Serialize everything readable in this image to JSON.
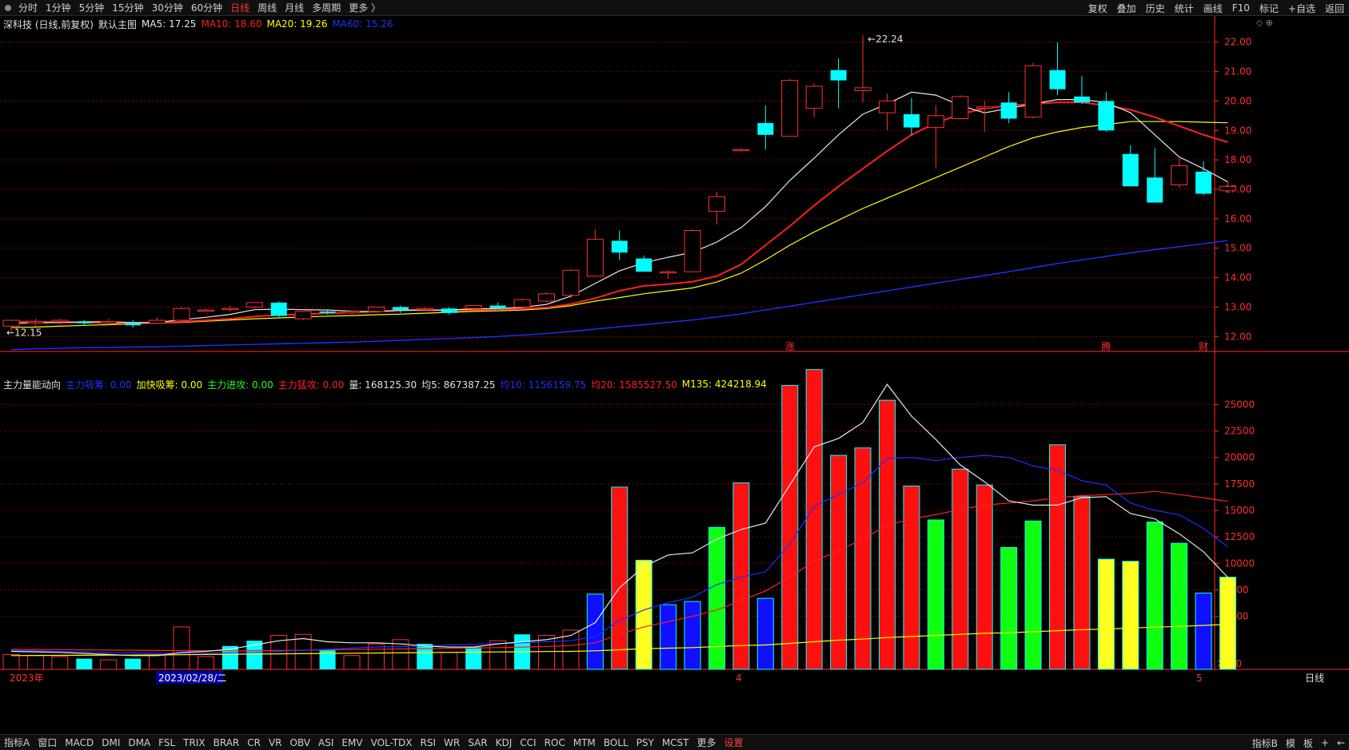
{
  "toolbar": {
    "periods": [
      "分时",
      "1分钟",
      "5分钟",
      "15分钟",
      "30分钟",
      "60分钟",
      "日线",
      "周线",
      "月线",
      "多周期",
      "更多 〉"
    ],
    "active_period": "日线",
    "actions": [
      "复权",
      "叠加",
      "历史",
      "统计",
      "画线",
      "F10",
      "标记",
      "+自选",
      "返回"
    ]
  },
  "main_legend": {
    "title": "深科技 (日线,前复权)",
    "template": "默认主图",
    "ma5": {
      "label": "MA5: 17.25",
      "color": "#e8e8e8"
    },
    "ma10": {
      "label": "MA10: 18.60",
      "color": "#ff2020"
    },
    "ma20": {
      "label": "MA20: 19.26",
      "color": "#ffff00"
    },
    "ma60": {
      "label": "MA60: 15.26",
      "color": "#2030ff"
    }
  },
  "sub_legend": {
    "title": "主力量能动向",
    "items": [
      {
        "label": "主力吸筹: 0.00",
        "color": "#2030ff"
      },
      {
        "label": "加快吸筹: 0.00",
        "color": "#ffff00"
      },
      {
        "label": "主力进攻: 0.00",
        "color": "#20ff20"
      },
      {
        "label": "主力猛攻: 0.00",
        "color": "#ff2020"
      },
      {
        "label": "量: 168125.30",
        "color": "#e0e0e0"
      },
      {
        "label": "均5: 867387.25",
        "color": "#e0e0e0"
      },
      {
        "label": "均10: 1156159.75",
        "color": "#2030ff"
      },
      {
        "label": "均20: 1585527.50",
        "color": "#ff2020"
      },
      {
        "label": "M135: 424218.94",
        "color": "#ffff00"
      }
    ]
  },
  "price_axis": [
    "22.00",
    "21.00",
    "20.00",
    "19.00",
    "18.00",
    "17.00",
    "16.00",
    "15.00",
    "14.00",
    "13.00",
    "12.00"
  ],
  "volume_axis": [
    "25000",
    "22500",
    "20000",
    "17500",
    "15000",
    "12500",
    "10000",
    "7500",
    "5000"
  ],
  "volume_unit": "X100",
  "annotations": {
    "high": "22.24",
    "low": "12.15",
    "markers": [
      "涨",
      "腾",
      "财"
    ]
  },
  "time_axis": {
    "year_label": "2023年",
    "cursor_date": "2023/02/28/二",
    "month_marks": [
      "4",
      "5"
    ]
  },
  "bottombar": {
    "tabs": [
      "指标A",
      "窗口",
      "MACD",
      "DMI",
      "DMA",
      "FSL",
      "TRIX",
      "BRAR",
      "CR",
      "VR",
      "OBV",
      "ASI",
      "EMV",
      "VOL-TDX",
      "RSI",
      "WR",
      "SAR",
      "KDJ",
      "CCI",
      "ROC",
      "MTM",
      "BOLL",
      "PSY",
      "MCST",
      "更多",
      "设置"
    ],
    "right": [
      "指标B",
      "模",
      "板",
      "+",
      "←"
    ]
  },
  "right_labels": {
    "period": "日线"
  },
  "colors": {
    "up": "#ff3030",
    "down": "#00ffff",
    "grid": "#8b0000",
    "axis": "#ff3030"
  },
  "chart_data": [
    {
      "type": "candlestick",
      "title": "深科技 (日线,前复权)",
      "ylim": [
        11.6,
        22.4
      ],
      "candles": [
        {
          "o": 12.35,
          "h": 12.55,
          "l": 12.15,
          "c": 12.55
        },
        {
          "o": 12.45,
          "h": 12.6,
          "l": 12.35,
          "c": 12.5
        },
        {
          "o": 12.5,
          "h": 12.6,
          "l": 12.4,
          "c": 12.55
        },
        {
          "o": 12.5,
          "h": 12.55,
          "l": 12.4,
          "c": 12.45
        },
        {
          "o": 12.45,
          "h": 12.6,
          "l": 12.4,
          "c": 12.5
        },
        {
          "o": 12.45,
          "h": 12.55,
          "l": 12.3,
          "c": 12.38
        },
        {
          "o": 12.45,
          "h": 12.65,
          "l": 12.45,
          "c": 12.55
        },
        {
          "o": 12.55,
          "h": 13.0,
          "l": 12.5,
          "c": 12.95
        },
        {
          "o": 12.88,
          "h": 12.95,
          "l": 12.85,
          "c": 12.9
        },
        {
          "o": 12.95,
          "h": 13.05,
          "l": 12.85,
          "c": 12.95
        },
        {
          "o": 13.0,
          "h": 13.15,
          "l": 12.95,
          "c": 13.15
        },
        {
          "o": 13.15,
          "h": 13.2,
          "l": 12.65,
          "c": 12.7
        },
        {
          "o": 12.6,
          "h": 12.85,
          "l": 12.55,
          "c": 12.85
        },
        {
          "o": 12.85,
          "h": 12.9,
          "l": 12.75,
          "c": 12.8
        },
        {
          "o": 12.8,
          "h": 12.85,
          "l": 12.75,
          "c": 12.85
        },
        {
          "o": 12.85,
          "h": 13.0,
          "l": 12.8,
          "c": 13.0
        },
        {
          "o": 13.0,
          "h": 13.05,
          "l": 12.8,
          "c": 12.9
        },
        {
          "o": 12.95,
          "h": 13.0,
          "l": 12.9,
          "c": 12.95
        },
        {
          "o": 12.95,
          "h": 13.0,
          "l": 12.75,
          "c": 12.8
        },
        {
          "o": 12.95,
          "h": 13.05,
          "l": 12.9,
          "c": 13.05
        },
        {
          "o": 13.05,
          "h": 13.15,
          "l": 12.95,
          "c": 12.95
        },
        {
          "o": 13.0,
          "h": 13.3,
          "l": 12.95,
          "c": 13.25
        },
        {
          "o": 13.2,
          "h": 13.5,
          "l": 13.15,
          "c": 13.45
        },
        {
          "o": 13.4,
          "h": 14.3,
          "l": 13.3,
          "c": 14.25
        },
        {
          "o": 14.05,
          "h": 15.65,
          "l": 14.05,
          "c": 15.3
        },
        {
          "o": 15.25,
          "h": 15.6,
          "l": 14.6,
          "c": 14.85
        },
        {
          "o": 14.65,
          "h": 14.75,
          "l": 14.2,
          "c": 14.2
        },
        {
          "o": 14.2,
          "h": 14.25,
          "l": 13.95,
          "c": 14.2
        },
        {
          "o": 14.2,
          "h": 15.65,
          "l": 14.2,
          "c": 15.6
        },
        {
          "o": 16.25,
          "h": 16.9,
          "l": 15.8,
          "c": 16.75
        },
        {
          "o": 18.35,
          "h": 18.4,
          "l": 18.3,
          "c": 18.35
        },
        {
          "o": 19.25,
          "h": 19.85,
          "l": 18.35,
          "c": 18.85
        },
        {
          "o": 18.8,
          "h": 20.75,
          "l": 18.8,
          "c": 20.7
        },
        {
          "o": 19.75,
          "h": 20.6,
          "l": 19.45,
          "c": 20.5
        },
        {
          "o": 21.05,
          "h": 21.45,
          "l": 19.75,
          "c": 20.7
        },
        {
          "o": 20.35,
          "h": 22.24,
          "l": 19.95,
          "c": 20.45
        },
        {
          "o": 19.6,
          "h": 20.25,
          "l": 19.0,
          "c": 20.0
        },
        {
          "o": 19.55,
          "h": 20.1,
          "l": 18.85,
          "c": 19.1
        },
        {
          "o": 19.1,
          "h": 19.85,
          "l": 17.7,
          "c": 19.5
        },
        {
          "o": 19.4,
          "h": 20.2,
          "l": 19.4,
          "c": 20.15
        },
        {
          "o": 19.75,
          "h": 20.0,
          "l": 18.95,
          "c": 19.8
        },
        {
          "o": 19.95,
          "h": 20.3,
          "l": 19.25,
          "c": 19.4
        },
        {
          "o": 19.45,
          "h": 21.3,
          "l": 19.4,
          "c": 21.2
        },
        {
          "o": 21.05,
          "h": 22.0,
          "l": 20.2,
          "c": 20.4
        },
        {
          "o": 20.15,
          "h": 20.85,
          "l": 19.9,
          "c": 19.95
        },
        {
          "o": 20.0,
          "h": 20.3,
          "l": 18.95,
          "c": 19.0
        },
        {
          "o": 18.2,
          "h": 18.5,
          "l": 17.1,
          "c": 17.1
        },
        {
          "o": 17.4,
          "h": 18.4,
          "l": 16.55,
          "c": 16.55
        },
        {
          "o": 17.15,
          "h": 18.1,
          "l": 17.05,
          "c": 17.8
        },
        {
          "o": 17.6,
          "h": 17.95,
          "l": 16.8,
          "c": 16.85
        },
        {
          "o": 16.95,
          "h": 17.25,
          "l": 16.95,
          "c": 17.1
        }
      ],
      "ma5": [
        12.45,
        12.46,
        12.48,
        12.5,
        12.5,
        12.47,
        12.48,
        12.57,
        12.65,
        12.75,
        12.91,
        12.93,
        12.91,
        12.9,
        12.86,
        12.84,
        12.88,
        12.9,
        12.9,
        12.94,
        12.95,
        12.99,
        13.09,
        13.37,
        13.8,
        14.23,
        14.5,
        14.69,
        14.86,
        15.21,
        15.7,
        16.41,
        17.3,
        18.06,
        18.85,
        19.55,
        19.9,
        20.3,
        20.2,
        19.85,
        19.6,
        19.75,
        19.9,
        20.05,
        20.05,
        19.95,
        19.6,
        18.85,
        18.1,
        17.7,
        17.25
      ],
      "ma10": [
        12.5,
        12.5,
        12.48,
        12.47,
        12.46,
        12.45,
        12.46,
        12.5,
        12.55,
        12.6,
        12.68,
        12.73,
        12.75,
        12.79,
        12.81,
        12.85,
        12.9,
        12.9,
        12.88,
        12.9,
        12.91,
        12.94,
        12.98,
        13.1,
        13.3,
        13.55,
        13.72,
        13.78,
        13.86,
        14.05,
        14.45,
        15.1,
        15.75,
        16.45,
        17.1,
        17.7,
        18.3,
        18.85,
        19.25,
        19.55,
        19.75,
        19.85,
        19.9,
        19.95,
        19.95,
        19.85,
        19.7,
        19.45,
        19.15,
        18.85,
        18.6
      ],
      "ma20": [
        12.3,
        12.32,
        12.35,
        12.38,
        12.4,
        12.43,
        12.45,
        12.48,
        12.52,
        12.56,
        12.6,
        12.63,
        12.66,
        12.69,
        12.71,
        12.74,
        12.76,
        12.79,
        12.82,
        12.85,
        12.87,
        12.9,
        12.95,
        13.05,
        13.2,
        13.32,
        13.45,
        13.55,
        13.65,
        13.85,
        14.15,
        14.6,
        15.1,
        15.55,
        15.95,
        16.35,
        16.7,
        17.05,
        17.4,
        17.75,
        18.1,
        18.45,
        18.75,
        18.95,
        19.1,
        19.2,
        19.3,
        19.3,
        19.3,
        19.28,
        19.26
      ],
      "ma60": [
        11.55,
        11.58,
        11.6,
        11.62,
        11.63,
        11.64,
        11.65,
        11.67,
        11.69,
        11.71,
        11.73,
        11.75,
        11.77,
        11.79,
        11.81,
        11.84,
        11.87,
        11.9,
        11.93,
        11.96,
        12.0,
        12.05,
        12.1,
        12.17,
        12.25,
        12.33,
        12.4,
        12.48,
        12.56,
        12.66,
        12.77,
        12.9,
        13.03,
        13.16,
        13.29,
        13.42,
        13.55,
        13.68,
        13.81,
        13.94,
        14.07,
        14.2,
        14.34,
        14.48,
        14.6,
        14.72,
        14.84,
        14.95,
        15.05,
        15.15,
        15.26
      ]
    },
    {
      "type": "bar",
      "title": "主力量能动向",
      "ylim": [
        0,
        28500
      ],
      "volumes": [
        1400,
        1300,
        1200,
        1000,
        900,
        1000,
        1300,
        4000,
        1200,
        2200,
        2700,
        3200,
        3300,
        1800,
        1300,
        2400,
        2800,
        2400,
        1600,
        2100,
        2700,
        3300,
        3200,
        3700,
        7100,
        17200,
        10300,
        6100,
        6400,
        13400,
        17600,
        6700,
        26800,
        28300,
        20200,
        20900,
        25400,
        17300,
        14100,
        18900,
        17400,
        11500,
        14000,
        21200,
        16300,
        10400,
        10200,
        13900,
        11900,
        7200,
        8700
      ],
      "bar_types": [
        "up",
        "up",
        "up",
        "down",
        "up",
        "down",
        "up",
        "up",
        "up",
        "down",
        "down",
        "up",
        "up",
        "down",
        "up",
        "up",
        "up",
        "down",
        "up",
        "down",
        "up",
        "down",
        "up",
        "up",
        "blue",
        "red",
        "yellow",
        "blue",
        "blue",
        "green",
        "red",
        "blue",
        "red",
        "red",
        "red",
        "red",
        "red",
        "red",
        "green",
        "red",
        "red",
        "green",
        "green",
        "red",
        "red",
        "yellow",
        "yellow",
        "green",
        "green",
        "blue",
        "yellow"
      ],
      "ma5": [
        1700,
        1650,
        1600,
        1500,
        1400,
        1300,
        1300,
        1600,
        1700,
        1900,
        2300,
        2700,
        2900,
        2600,
        2500,
        2500,
        2400,
        2200,
        2100,
        2100,
        2400,
        2600,
        2800,
        3200,
        4400,
        7700,
        9700,
        10800,
        11000,
        12300,
        13200,
        13800,
        17400,
        21000,
        21800,
        23300,
        26900,
        23900,
        21700,
        19300,
        17700,
        15900,
        15500,
        15500,
        16200,
        16300,
        14700,
        14200,
        12800,
        11100,
        8673
      ],
      "ma10": [
        1800,
        1750,
        1700,
        1650,
        1600,
        1550,
        1500,
        1500,
        1520,
        1560,
        1600,
        1700,
        1800,
        1900,
        2000,
        2100,
        2150,
        2200,
        2300,
        2350,
        2450,
        2500,
        2600,
        2700,
        3100,
        4600,
        5600,
        6300,
        6800,
        8000,
        8700,
        9200,
        11800,
        15400,
        16500,
        17600,
        19900,
        20000,
        19700,
        20000,
        20200,
        20000,
        19200,
        18800,
        17800,
        17400,
        15700,
        15000,
        14600,
        13300,
        11562
      ],
      "ma20": [
        1900,
        1880,
        1860,
        1840,
        1820,
        1800,
        1780,
        1770,
        1760,
        1760,
        1770,
        1790,
        1810,
        1840,
        1870,
        1900,
        1920,
        1950,
        1980,
        2000,
        2050,
        2100,
        2150,
        2250,
        2500,
        3300,
        4000,
        4500,
        5000,
        5600,
        6500,
        7400,
        8700,
        10200,
        11200,
        12300,
        13600,
        14200,
        14600,
        15100,
        15500,
        15700,
        15900,
        16200,
        16400,
        16500,
        16600,
        16800,
        16500,
        16200,
        15855
      ],
      "m135": [
        1300,
        1310,
        1320,
        1330,
        1340,
        1350,
        1360,
        1380,
        1400,
        1420,
        1440,
        1460,
        1480,
        1500,
        1520,
        1540,
        1560,
        1580,
        1600,
        1620,
        1640,
        1660,
        1680,
        1700,
        1750,
        1850,
        1950,
        2000,
        2050,
        2150,
        2250,
        2300,
        2450,
        2600,
        2750,
        2850,
        3000,
        3100,
        3200,
        3300,
        3400,
        3450,
        3550,
        3650,
        3750,
        3800,
        3900,
        3980,
        4050,
        4150,
        4242
      ]
    }
  ]
}
